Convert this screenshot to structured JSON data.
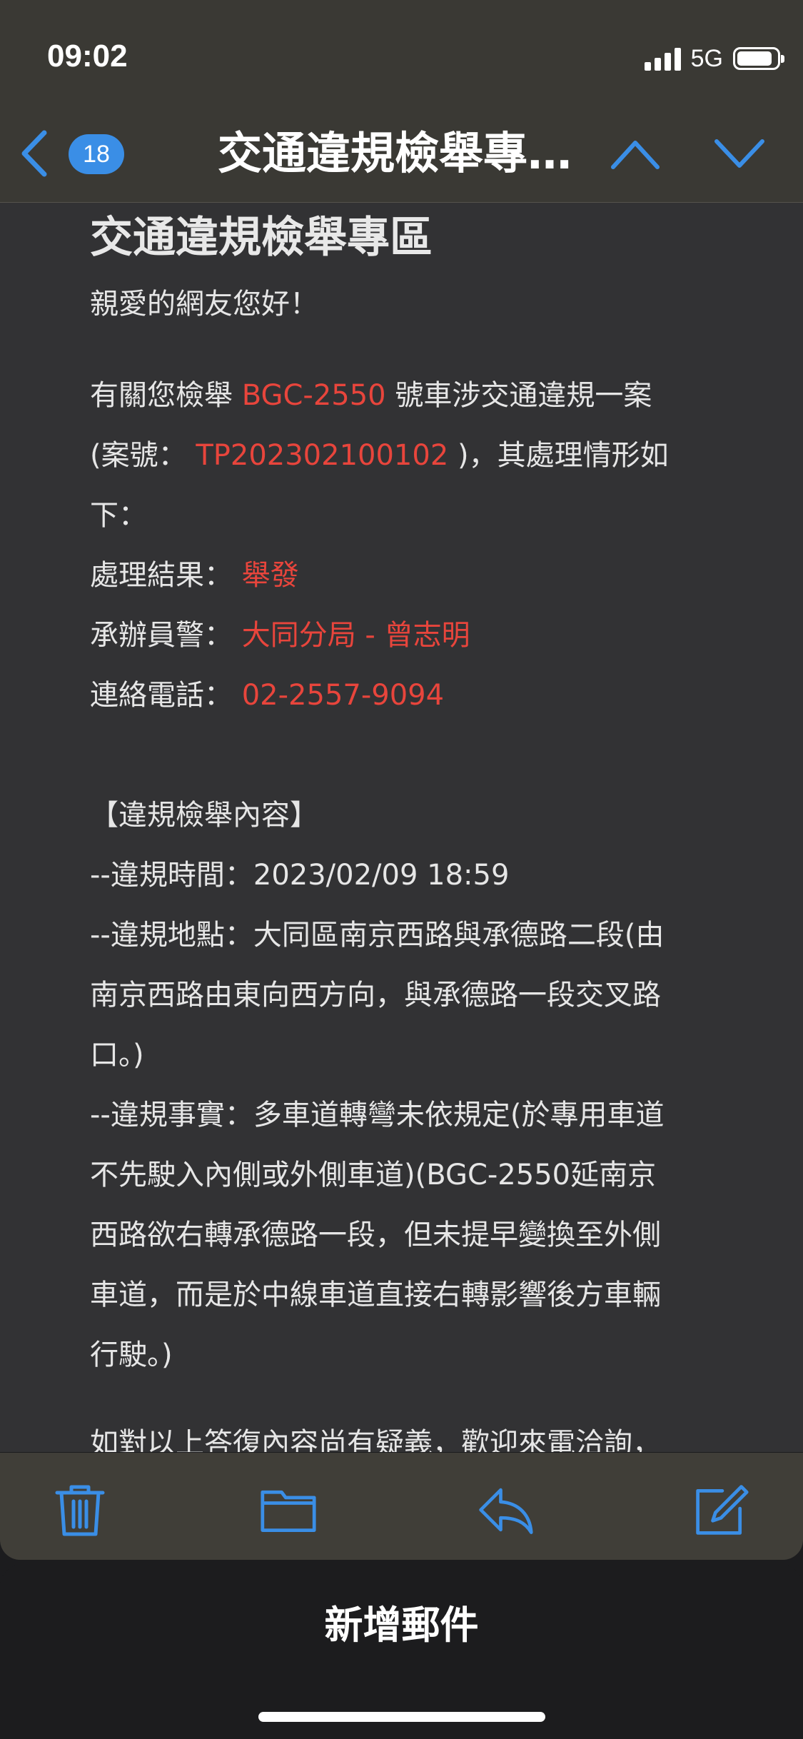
{
  "status_bar": {
    "time": "09:02",
    "network": "5G"
  },
  "nav": {
    "unread_count": "18",
    "title": "交通違規檢舉專…"
  },
  "email": {
    "heading": "交通違規檢舉專區",
    "greeting": "親愛的網友您好！",
    "intro_1a": "有關您檢舉",
    "plate": "BGC-2550",
    "intro_1b": "號車涉交通違規一案",
    "intro_2a": "(案號：",
    "case_no": "TP202302100102",
    "intro_2b": ")，其處理情形如",
    "intro_3": "下：",
    "result_label": "處理結果：",
    "result_value": "舉發",
    "officer_label": "承辦員警：",
    "officer_value": "大同分局 - 曾志明",
    "phone_label": "連絡電話：",
    "phone_value": "02-2557-9094",
    "section_title": "【違規檢舉內容】",
    "time_line": "--違規時間：2023/02/09 18:59",
    "place_1": "--違規地點：大同區南京西路與承德路二段(由",
    "place_2": "南京西路由東向西方向，與承德路一段交叉路",
    "place_3": "口。)",
    "fact_1": "--違規事實：多車道轉彎未依規定(於專用車道",
    "fact_2": "不先駛入內側或外側車道)(BGC-2550延南京",
    "fact_3": "西路欲右轉承德路一段，但未提早變換至外側",
    "fact_4": "車道，而是於中線車道直接右轉影響後方車輛",
    "fact_5": "行駛。)",
    "footer_partial": "如對以上答復內容尚有疑義，歡迎來電洽詢，"
  },
  "toolbar": {
    "icons": [
      "trash-icon",
      "folder-icon",
      "reply-icon",
      "compose-icon"
    ]
  },
  "sheet": {
    "title": "新增郵件"
  },
  "colors": {
    "accent": "#3a8ee6",
    "highlight": "#e8453c"
  }
}
